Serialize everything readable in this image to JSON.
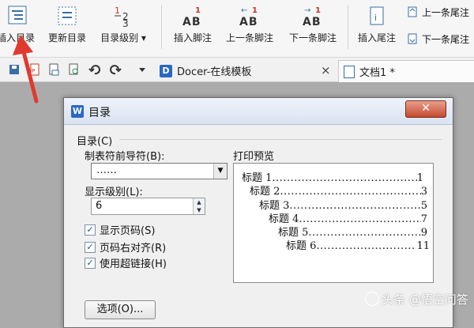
{
  "ribbon": {
    "buttons": [
      {
        "label": "插入目录",
        "icon": "toc-insert-icon"
      },
      {
        "label": "更新目录",
        "icon": "toc-update-icon"
      },
      {
        "label": "目录级别 ▾",
        "icon": "toc-level-icon"
      },
      {
        "label": "插入脚注",
        "icon": "footnote-insert-icon"
      },
      {
        "label": "上一条脚注",
        "icon": "footnote-prev-icon"
      },
      {
        "label": "下一条脚注",
        "icon": "footnote-next-icon"
      },
      {
        "label": "插入尾注",
        "icon": "endnote-insert-icon"
      }
    ],
    "side_buttons": [
      {
        "label": "上一条尾注",
        "icon": "endnote-prev-icon"
      },
      {
        "label": "下一条尾注",
        "icon": "endnote-next-icon"
      }
    ]
  },
  "tabs": [
    {
      "label": "Docer-在线模板",
      "close": "×"
    },
    {
      "label": "文档1 *"
    }
  ],
  "dialog": {
    "title": "目录",
    "close": "✕",
    "group_caption": "目录(C)",
    "leader_label": "制表符前导符(B):",
    "leader_value": "……",
    "levels_label": "显示级别(L):",
    "levels_value": "6",
    "checkboxes": [
      {
        "label": "显示页码(S)",
        "checked": true
      },
      {
        "label": "页码右对齐(R)",
        "checked": true
      },
      {
        "label": "使用超链接(H)",
        "checked": true
      }
    ],
    "options_button": "选项(O)...",
    "preview_label": "打印预览",
    "preview_entries": [
      {
        "text": "标题 1",
        "page": "1"
      },
      {
        "text": "标题 2",
        "page": "3"
      },
      {
        "text": "标题 3",
        "page": "5"
      },
      {
        "text": "标题 4",
        "page": "7"
      },
      {
        "text": "标题 5",
        "page": "9"
      },
      {
        "text": "标题 6",
        "page": "11"
      }
    ]
  },
  "watermark": "头条 @悟空问答",
  "colors": {
    "accent_arrow": "#e03a2e",
    "titlebar": "#dde6f2",
    "close_red": "#c9432a"
  }
}
